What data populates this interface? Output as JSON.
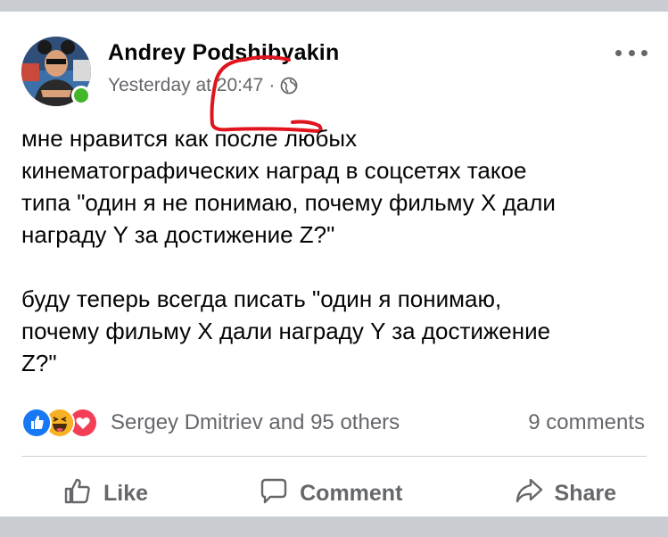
{
  "post": {
    "author": "Andrey Podshibyakin",
    "timestamp": "Yesterday at 20:47",
    "separator": "·",
    "privacy_icon": "globe-icon",
    "paragraphs": [
      "мне нравится как после любых\nкинематографических наград в соцсетях такое\nтипа \"один я не понимаю, почему фильму X дали\nнаграду Y за достижение Z?\"",
      "буду теперь всегда писать \"один я понимаю,\nпочему фильму X дали награду Y за достижение\nZ?\""
    ]
  },
  "reactions": {
    "icons": [
      "like-icon",
      "haha-icon",
      "love-icon"
    ],
    "text": "Sergey Dmitriev and 95 others",
    "comments": "9 comments"
  },
  "actions": {
    "like": "Like",
    "comment": "Comment",
    "share": "Share"
  },
  "colors": {
    "like_blue": "#1877f2",
    "love_red": "#f33e58",
    "haha_yellow": "#f7b125",
    "annotation_red": "#e0141e",
    "online_green": "#42b72a"
  }
}
